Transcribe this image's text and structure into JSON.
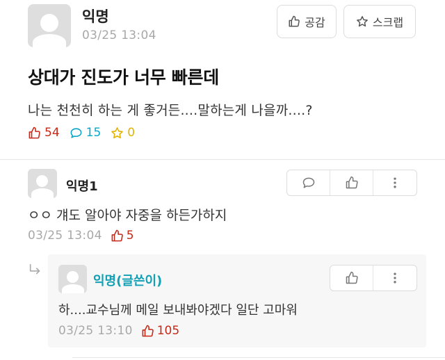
{
  "post": {
    "author": "익명",
    "time": "03/25 13:04",
    "like_button_label": "공감",
    "scrap_button_label": "스크랩",
    "title": "상대가 진도가 너무 빠른데",
    "body": "나는 천천히 하는 게 좋거든....말하는게 나을까....?",
    "likes": "54",
    "comments": "15",
    "scraps": "0"
  },
  "comment": {
    "author": "익명1",
    "text": "ㅇㅇ 걔도 알아야 자중을 하든가하지",
    "time": "03/25 13:04",
    "likes": "5"
  },
  "reply": {
    "author": "익명(글쓴이)",
    "text": "하....교수님께 메일 보내봐야겠다 일단 고마워",
    "time": "03/25 13:10",
    "likes": "105"
  },
  "colors": {
    "like": "#c62917",
    "comment": "#0aa6c9",
    "scrap": "#e2b300",
    "op_author": "#11a0b4"
  },
  "icons": [
    "thumbs-up-icon",
    "star-icon",
    "speech-bubble-icon",
    "more-vertical-icon",
    "reply-arrow-icon",
    "avatar-icon"
  ]
}
